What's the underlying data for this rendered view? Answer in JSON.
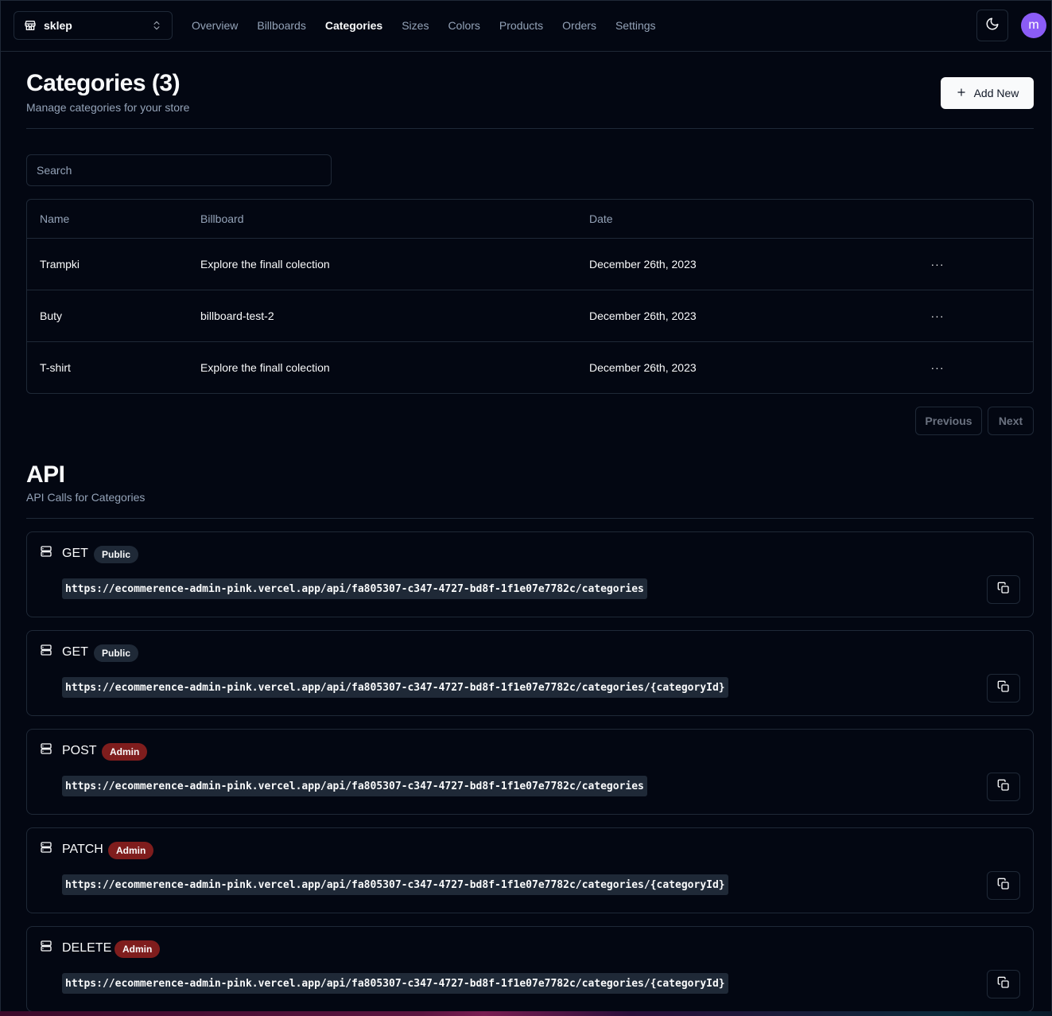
{
  "store": {
    "name": "sklep"
  },
  "nav": {
    "links": [
      {
        "label": "Overview"
      },
      {
        "label": "Billboards"
      },
      {
        "label": "Categories"
      },
      {
        "label": "Sizes"
      },
      {
        "label": "Colors"
      },
      {
        "label": "Products"
      },
      {
        "label": "Orders"
      },
      {
        "label": "Settings"
      }
    ],
    "active": "Categories",
    "avatar_letter": "m"
  },
  "header": {
    "title": "Categories (3)",
    "subtitle": "Manage categories for your store",
    "add_button_label": "Add New"
  },
  "search": {
    "placeholder": "Search"
  },
  "table": {
    "columns": [
      "Name",
      "Billboard",
      "Date"
    ],
    "rows": [
      {
        "name": "Trampki",
        "billboard": "Explore the finall colection",
        "date": "December 26th, 2023"
      },
      {
        "name": "Buty",
        "billboard": "billboard-test-2",
        "date": "December 26th, 2023"
      },
      {
        "name": "T-shirt",
        "billboard": "Explore the finall colection",
        "date": "December 26th, 2023"
      }
    ],
    "row_action_glyph": "···"
  },
  "pagination": {
    "previous_label": "Previous",
    "next_label": "Next"
  },
  "api": {
    "title": "API",
    "subtitle": "API Calls for Categories",
    "calls": [
      {
        "method": "GET",
        "badge": "Public",
        "url": "https://ecommerence-admin-pink.vercel.app/api/fa805307-c347-4727-bd8f-1f1e07e7782c/categories"
      },
      {
        "method": "GET",
        "badge": "Public",
        "url": "https://ecommerence-admin-pink.vercel.app/api/fa805307-c347-4727-bd8f-1f1e07e7782c/categories/{categoryId}"
      },
      {
        "method": "POST",
        "badge": "Admin",
        "url": "https://ecommerence-admin-pink.vercel.app/api/fa805307-c347-4727-bd8f-1f1e07e7782c/categories"
      },
      {
        "method": "PATCH",
        "badge": "Admin",
        "url": "https://ecommerence-admin-pink.vercel.app/api/fa805307-c347-4727-bd8f-1f1e07e7782c/categories/{categoryId}"
      },
      {
        "method": "DELETE",
        "badge": "Admin",
        "url": "https://ecommerence-admin-pink.vercel.app/api/fa805307-c347-4727-bd8f-1f1e07e7782c/categories/{categoryId}"
      }
    ]
  },
  "colors": {
    "background": "#030712",
    "border": "#1f2937",
    "muted_text": "#94a3b8",
    "admin_badge": "#7f1d1d",
    "avatar": "#8b5cf6"
  },
  "icons": {
    "store": "store-icon",
    "switcher": "chevrons-up-down-icon",
    "theme": "moon-icon",
    "add": "plus-icon",
    "row_action": "more-horizontal-icon",
    "api_call": "server-icon",
    "copy": "copy-icon"
  }
}
